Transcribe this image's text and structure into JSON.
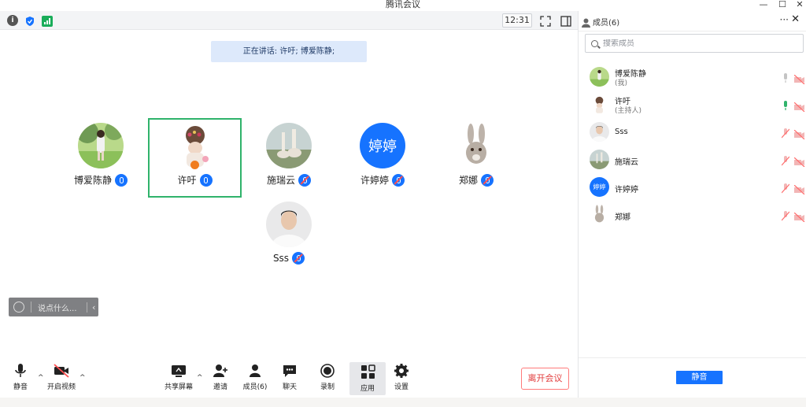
{
  "window": {
    "title": "腾讯会议",
    "minimize": "—",
    "maximize": "☐",
    "close": "✕"
  },
  "topbar": {
    "clock": "12:31"
  },
  "speaking": {
    "text": "正在讲话: 许吁; 博爱陈静;"
  },
  "participants": [
    {
      "name": "博爱陈静",
      "mic": "on"
    },
    {
      "name": "许吁",
      "mic": "on",
      "active": true
    },
    {
      "name": "施瑞云",
      "mic": "muted"
    },
    {
      "name": "许婷婷",
      "mic": "muted",
      "avatar_text": "婷婷"
    },
    {
      "name": "郑娜",
      "mic": "muted"
    },
    {
      "name": "Sss",
      "mic": "muted"
    }
  ],
  "chat": {
    "placeholder": "说点什么...",
    "chevron": "‹"
  },
  "toolbar": {
    "mute": "静音",
    "video": "开启视频",
    "share": "共享屏幕",
    "invite": "邀请",
    "members": "成员(6)",
    "chat": "聊天",
    "record": "录制",
    "apps": "应用",
    "settings": "设置",
    "leave": "离开会议",
    "caret": "^"
  },
  "panel": {
    "title": "成员(6)",
    "more": "···",
    "close": "✕",
    "search_placeholder": "搜索成员",
    "members": [
      {
        "name": "博爱陈静",
        "role": "(我)"
      },
      {
        "name": "许吁",
        "role": "(主持人)"
      },
      {
        "name": "Sss"
      },
      {
        "name": "施瑞云"
      },
      {
        "name": "许婷婷",
        "avatar_text": "婷婷"
      },
      {
        "name": "郑娜"
      }
    ],
    "mute_all": "静音"
  },
  "colors": {
    "accent": "#1673ff",
    "active_border": "#2fb36b",
    "danger": "#e23b3b"
  }
}
